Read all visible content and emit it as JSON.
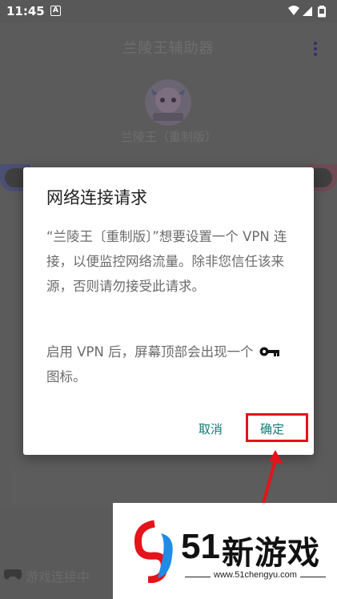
{
  "status_bar": {
    "time": "11:45",
    "notification_letter": "A",
    "icons": [
      "wifi-icon",
      "signal-icon",
      "battery-icon"
    ]
  },
  "background_app": {
    "title": "兰陵王辅助器",
    "subtitle": "兰陵王（重制版）",
    "bottom_item": "游戏连接中"
  },
  "dialog": {
    "title": "网络连接请求",
    "message": "“兰陵王〔重制版〕”想要设置一个 VPN 连接，以便监控网络流量。除非您信任该来源，否则请勿接受此请求。",
    "note_before_icon": "启用 VPN 后，屏幕顶部会出现一个",
    "note_after_icon": "图标。",
    "note_icon": "key-icon",
    "cancel_label": "取消",
    "ok_label": "确定"
  },
  "annotation": {
    "highlight_color": "#e3141a",
    "target": "ok-button"
  },
  "watermark": {
    "brand_number": "51",
    "brand_text": "新游戏",
    "url": "www.51chengyu.com"
  },
  "colors": {
    "button_text": "#117a74",
    "scrim": "#5e5e5e",
    "dialog_bg": "#ffffff"
  }
}
